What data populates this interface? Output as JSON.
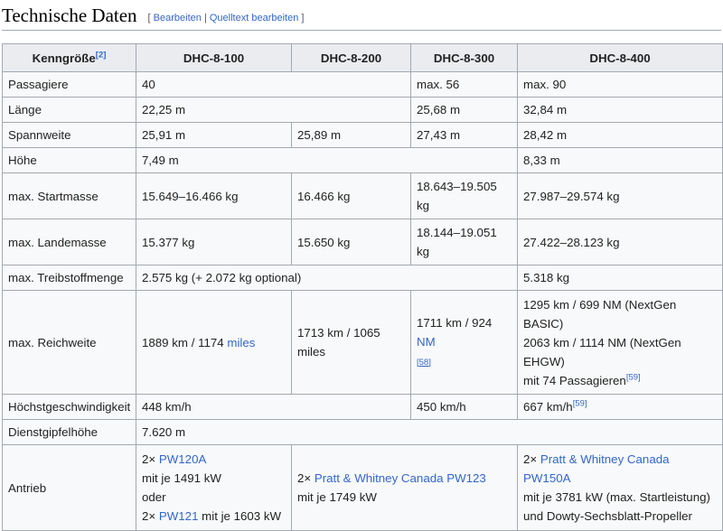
{
  "heading": {
    "title": "Technische Daten",
    "open_bracket": "[",
    "edit": "Bearbeiten",
    "separator": "|",
    "edit_source": "Quelltext bearbeiten",
    "close_bracket": "]"
  },
  "table": {
    "headers": {
      "param": "Kenngröße",
      "param_ref": "[2]",
      "c100": "DHC-8-100",
      "c200": "DHC-8-200",
      "c300": "DHC-8-300",
      "c400": "DHC-8-400"
    },
    "passagiere": {
      "label": "Passagiere",
      "v100_200": "40",
      "v300": "max. 56",
      "v400": "max. 90"
    },
    "laenge": {
      "label": "Länge",
      "v100_200": "22,25 m",
      "v300": "25,68 m",
      "v400": "32,84 m"
    },
    "spannweite": {
      "label": "Spannweite",
      "v100": "25,91 m",
      "v200": "25,89 m",
      "v300": "27,43 m",
      "v400": "28,42 m"
    },
    "hoehe": {
      "label": "Höhe",
      "v100_300": "7,49 m",
      "v400": "8,33 m"
    },
    "startmasse": {
      "label": "max. Startmasse",
      "v100": "15.649–16.466 kg",
      "v200": "16.466 kg",
      "v300": "18.643–19.505 kg",
      "v400": "27.987–29.574 kg"
    },
    "landemasse": {
      "label": "max. Landemasse",
      "v100": "15.377 kg",
      "v200": "15.650 kg",
      "v300": "18.144–19.051 kg",
      "v400": "27.422–28.123 kg"
    },
    "treibstoff": {
      "label": "max. Treibstoffmenge",
      "v100_300": "2.575 kg (+ 2.072 kg optional)",
      "v400": "5.318 kg"
    },
    "reichweite": {
      "label": "max. Reichweite",
      "v100_text": "1889 km / 1174 ",
      "v100_link": "miles",
      "v200": "1713 km / 1065 miles",
      "v300_text": "1711 km / 924 ",
      "v300_link": "NM",
      "v300_ref": "[58]",
      "v400_line1": "1295 km /   699 NM (NextGen BASIC)",
      "v400_line2": "2063 km / 1114 NM (NextGen EHGW)",
      "v400_line3": "mit 74 Passagieren",
      "v400_ref": "[59]"
    },
    "geschwindigkeit": {
      "label": "Höchstgeschwindigkeit",
      "v100_200": "448 km/h",
      "v300": "450 km/h",
      "v400": "667 km/h",
      "v400_ref": "[59]"
    },
    "gipfelhoehe": {
      "label": "Dienstgipfelhöhe",
      "v_all": "7.620 m"
    },
    "antrieb": {
      "label": "Antrieb",
      "v100_prefix": "2× ",
      "v100_link1": "PW120A",
      "v100_line2": "mit je 1491 kW",
      "v100_line3": "oder",
      "v100_prefix2": "2× ",
      "v100_link2": "PW121",
      "v100_suffix2": " mit je 1603 kW",
      "v200_300_prefix": "2× ",
      "v200_300_link": "Pratt & Whitney Canada PW123",
      "v200_300_line2": "mit je 1749 kW",
      "v400_prefix": "2× ",
      "v400_link": "Pratt & Whitney Canada PW150A",
      "v400_line2": "mit je 3781 kW (max. Startleistung)",
      "v400_line3": "und Dowty-Sechsblatt-Propeller"
    }
  }
}
